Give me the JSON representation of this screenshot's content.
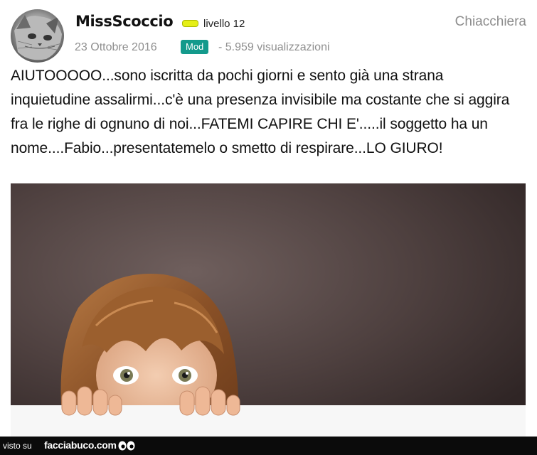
{
  "post": {
    "username": "MissScoccio",
    "level": "livello 12",
    "category": "Chiacchiera",
    "date": "23 Ottobre 2016",
    "role_badge": "Mod",
    "views": "- 5.959 visualizzazioni",
    "text": "AIUTOOOOO...sono iscritta da pochi giorni e sento già una strana inquietudine assalirmi...c'è una presenza invisibile ma costante che si aggira fra le righe di ognuno di noi...FATEMI CAPIRE CHI E'.....il soggetto ha un nome....Fabio...presentatemelo o smetto di respirare...LO GIURO!"
  },
  "footer": {
    "prefix": "visto su",
    "site": "facciabuco.com"
  },
  "colors": {
    "mod_badge": "#139a8c",
    "level_badge": "#e5ef16",
    "footer_bg": "#0b0b0b"
  },
  "icons": {
    "avatar": "cat-avatar",
    "level": "level-bar-icon",
    "footer_logo": "eyes-icon"
  }
}
